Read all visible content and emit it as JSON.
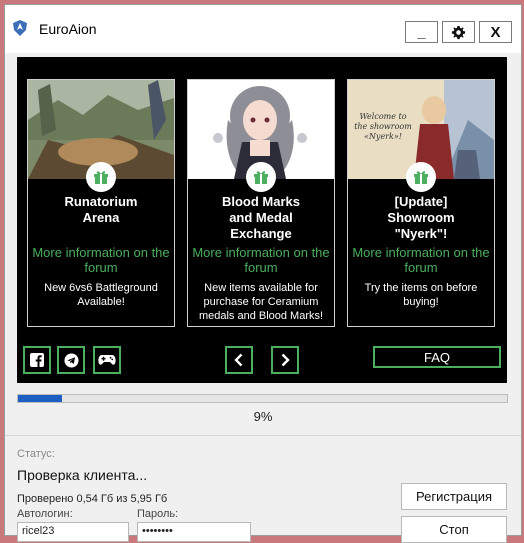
{
  "window": {
    "title": "EuroAion",
    "minimize_label": "_",
    "settings_icon": "gear-icon",
    "close_label": "X"
  },
  "news": {
    "cards": [
      {
        "title": "Runatorium\nArena",
        "link": "More information on the forum",
        "description": "New 6vs6 Battleground Available!",
        "image": "arena-screenshot"
      },
      {
        "title": "Blood Marks\nand Medal\nExchange",
        "link": "More information on the forum",
        "description": "New items available for purchase for Ceramium medals and Blood Marks!",
        "image": "anime-character-art"
      },
      {
        "title": "[Update]\nShowroom\n\"Nyerk\"!",
        "link": "More information on the forum",
        "description": "Try the items on before buying!",
        "image": "showroom-art",
        "image_caption": "Welcome to the showroom «Nyerk»!"
      }
    ],
    "social": [
      "facebook-icon",
      "telegram-icon",
      "gamepad-icon"
    ],
    "prev_icon": "chevron-left-icon",
    "next_icon": "chevron-right-icon",
    "faq_label": "FAQ"
  },
  "progress": {
    "value": 0.09,
    "percent_label": "9%"
  },
  "status": {
    "label": "Статус:",
    "text": "Проверка клиента...",
    "checked": "Проверено 0,54 Гб из 5,95 Гб"
  },
  "buttons": {
    "register": "Регистрация",
    "stop": "Стоп"
  },
  "login": {
    "autologin_label": "Автологин:",
    "autologin_value": "ricel23",
    "password_label": "Пароль:",
    "password_value": "••••••••"
  },
  "colors": {
    "accent_green": "#4cae5f",
    "progress_blue": "#1e5fc4",
    "desktop": "#c9797b"
  }
}
